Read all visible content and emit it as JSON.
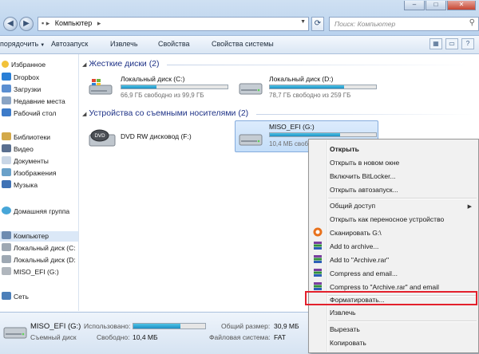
{
  "address": {
    "crumb": "Компьютер",
    "search_placeholder": "Поиск: Компьютер"
  },
  "toolbar": {
    "organize": "порядочить",
    "autorun": "Автозапуск",
    "eject": "Извлечь",
    "properties": "Свойства",
    "system_properties": "Свойства системы"
  },
  "nav": {
    "favorites": "Избранное",
    "dropbox": "Dropbox",
    "downloads": "Загрузки",
    "recent": "Недавние места",
    "desktop": "Рабочий стол",
    "libraries": "Библиотеки",
    "video": "Видео",
    "documents": "Документы",
    "images": "Изображения",
    "music": "Музыка",
    "homegroup": "Домашняя группа",
    "computer": "Компьютер",
    "disk_c": "Локальный диск (С:",
    "disk_d": "Локальный диск (D:",
    "miso": "MISO_EFI (G:)",
    "network": "Сеть"
  },
  "content": {
    "hdd_group": "Жесткие диски (2)",
    "removable_group": "Устройства со съемными носителями (2)",
    "disk_c": {
      "name": "Локальный диск (C:)",
      "free": "66,9 ГБ свободно из 99,9 ГБ",
      "used_fraction": 0.33
    },
    "disk_d": {
      "name": "Локальный диск (D:)",
      "free": "78,7 ГБ свободно из 259 ГБ",
      "used_fraction": 0.7
    },
    "dvd": {
      "name": "DVD RW дисковод (F:)"
    },
    "miso": {
      "name": "MISO_EFI (G:)",
      "free": "10,4 МБ свободно",
      "used_fraction": 0.66
    }
  },
  "details": {
    "name": "MISO_EFI (G:)",
    "type": "Съемный диск",
    "used_label": "Использовано:",
    "free_label": "Свободно:",
    "free_value": "10,4 МБ",
    "size_label": "Общий размер:",
    "size_value": "30,9 МБ",
    "fs_label": "Файловая система:",
    "fs_value": "FAT",
    "used_fraction": 0.66
  },
  "menu": {
    "open": "Открыть",
    "open_new_window": "Открыть в новом окне",
    "bitlocker": "Включить BitLocker...",
    "autorun": "Открыть автозапуск...",
    "share": "Общий доступ",
    "portable": "Открыть как переносное устройство",
    "scan": "Сканировать G:\\",
    "add_archive": "Add to archive...",
    "add_rar": "Add to \"Archive.rar\"",
    "compress_email": "Compress and email...",
    "compress_rar_email": "Compress to \"Archive.rar\" and email",
    "format": "Форматировать...",
    "eject": "Извлечь",
    "cut": "Вырезать",
    "copy": "Копировать"
  },
  "colors": {
    "accent": "#1e3287",
    "highlight_box": "#e3202c",
    "bar_fill": "#1e8fc4"
  }
}
